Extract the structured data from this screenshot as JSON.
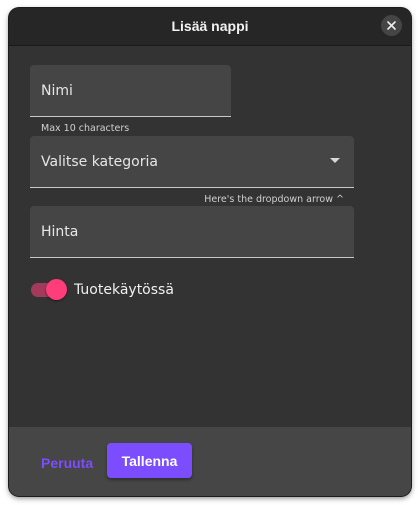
{
  "dialog": {
    "title": "Lisää nappi",
    "close_icon": "close-icon"
  },
  "form": {
    "name": {
      "value": "Nimi",
      "hint": "Max 10 characters"
    },
    "category": {
      "value": "Valitse kategoria",
      "hint": "Here's the dropdown arrow ^",
      "arrow_icon": "dropdown-arrow-icon"
    },
    "price": {
      "value": "Hinta"
    },
    "in_use_toggle": {
      "label": "Tuotekäytössä",
      "checked": true
    }
  },
  "footer": {
    "cancel_label": "Peruuta",
    "save_label": "Tallenna"
  },
  "colors": {
    "accent": "#7c4dff",
    "toggle_thumb": "#ff3d7a",
    "toggle_track": "#a33a5c",
    "dialog_background": "#333333",
    "titlebar_background": "#262626",
    "footer_background": "#464646",
    "field_background": "#454545"
  }
}
